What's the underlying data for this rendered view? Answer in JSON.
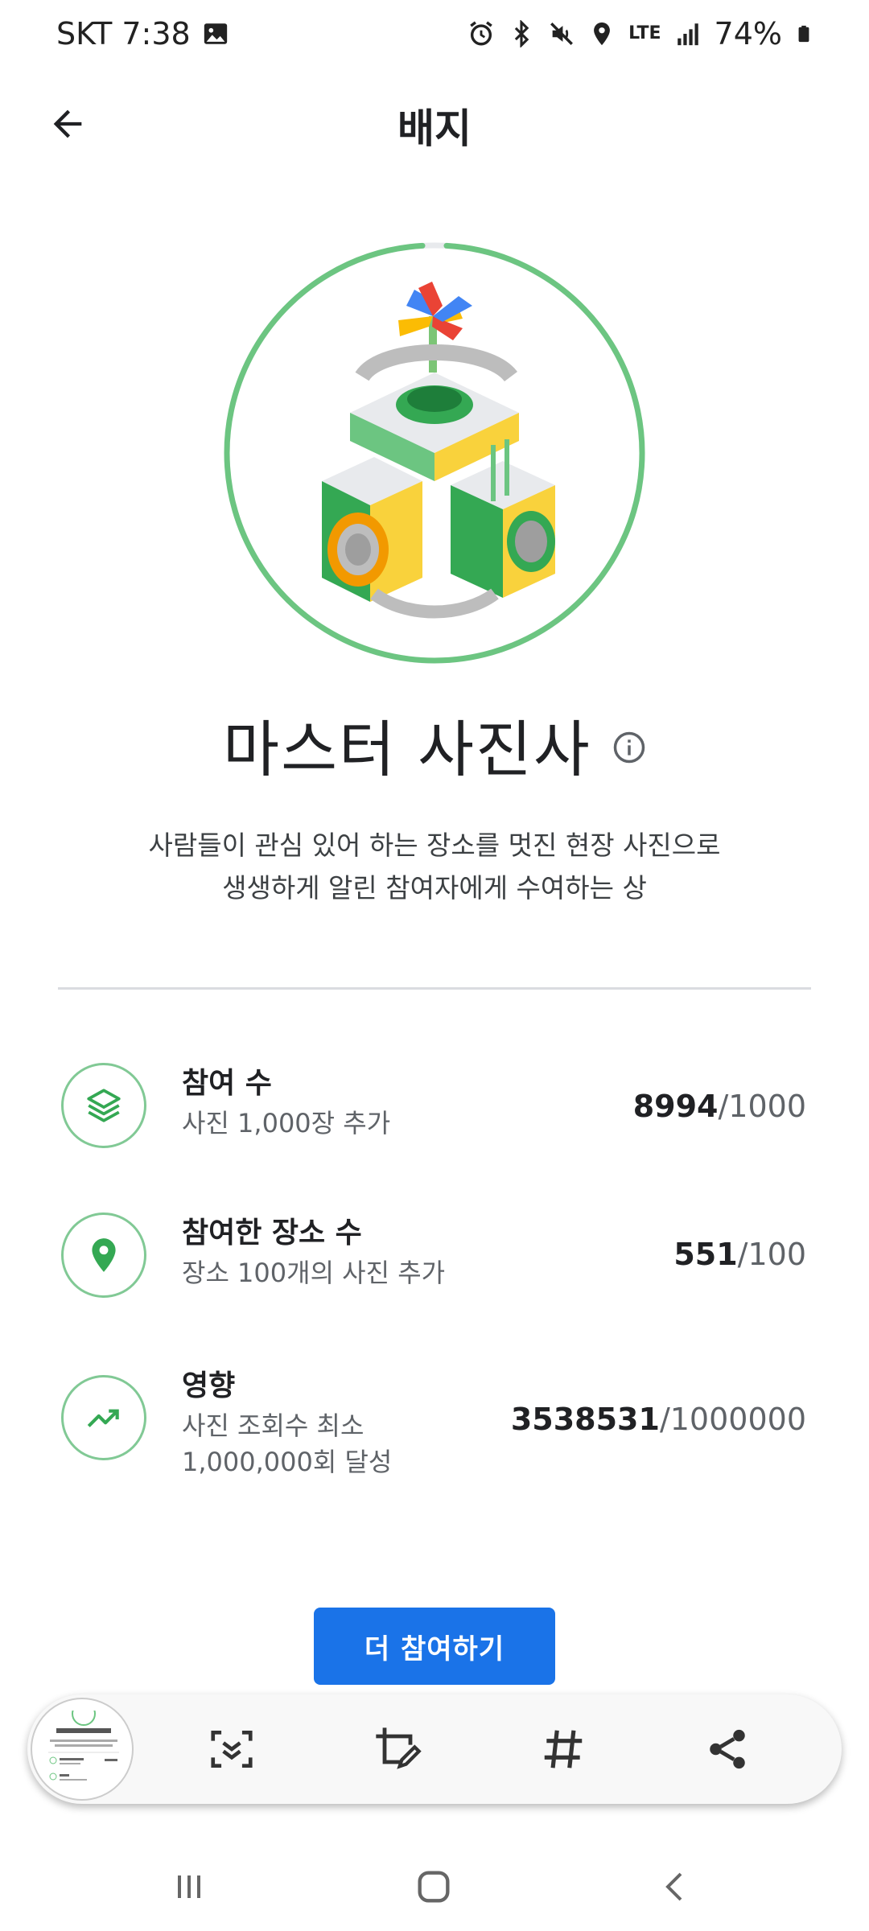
{
  "status_bar": {
    "carrier_time": "SKT 7:38",
    "battery": "74%",
    "network": "LTE"
  },
  "app_bar": {
    "title": "배지"
  },
  "badge": {
    "name": "마스터 사진사",
    "description_line1": "사람들이 관심 있어 하는 장소를 멋진 현장 사진으로",
    "description_line2": "생생하게 알린 참여자에게 수여하는 상",
    "ring_color": "#6cc581"
  },
  "stats": [
    {
      "icon": "layers-icon",
      "title": "참여 수",
      "subtitle": "사진 1,000장 추가",
      "current": "8994",
      "target": "/1000"
    },
    {
      "icon": "location-pin-icon",
      "title": "참여한 장소 수",
      "subtitle": "장소 100개의 사진 추가",
      "current": "551",
      "target": "/100"
    },
    {
      "icon": "trending-up-icon",
      "title": "영향",
      "subtitle_line1": "사진 조회수 최소",
      "subtitle_line2": "1,000,000회 달성",
      "current": "3538531",
      "target": "/1000000"
    }
  ],
  "cta": {
    "label": "더 참여하기",
    "color": "#1a73e8"
  },
  "accent_green": "#34a853"
}
